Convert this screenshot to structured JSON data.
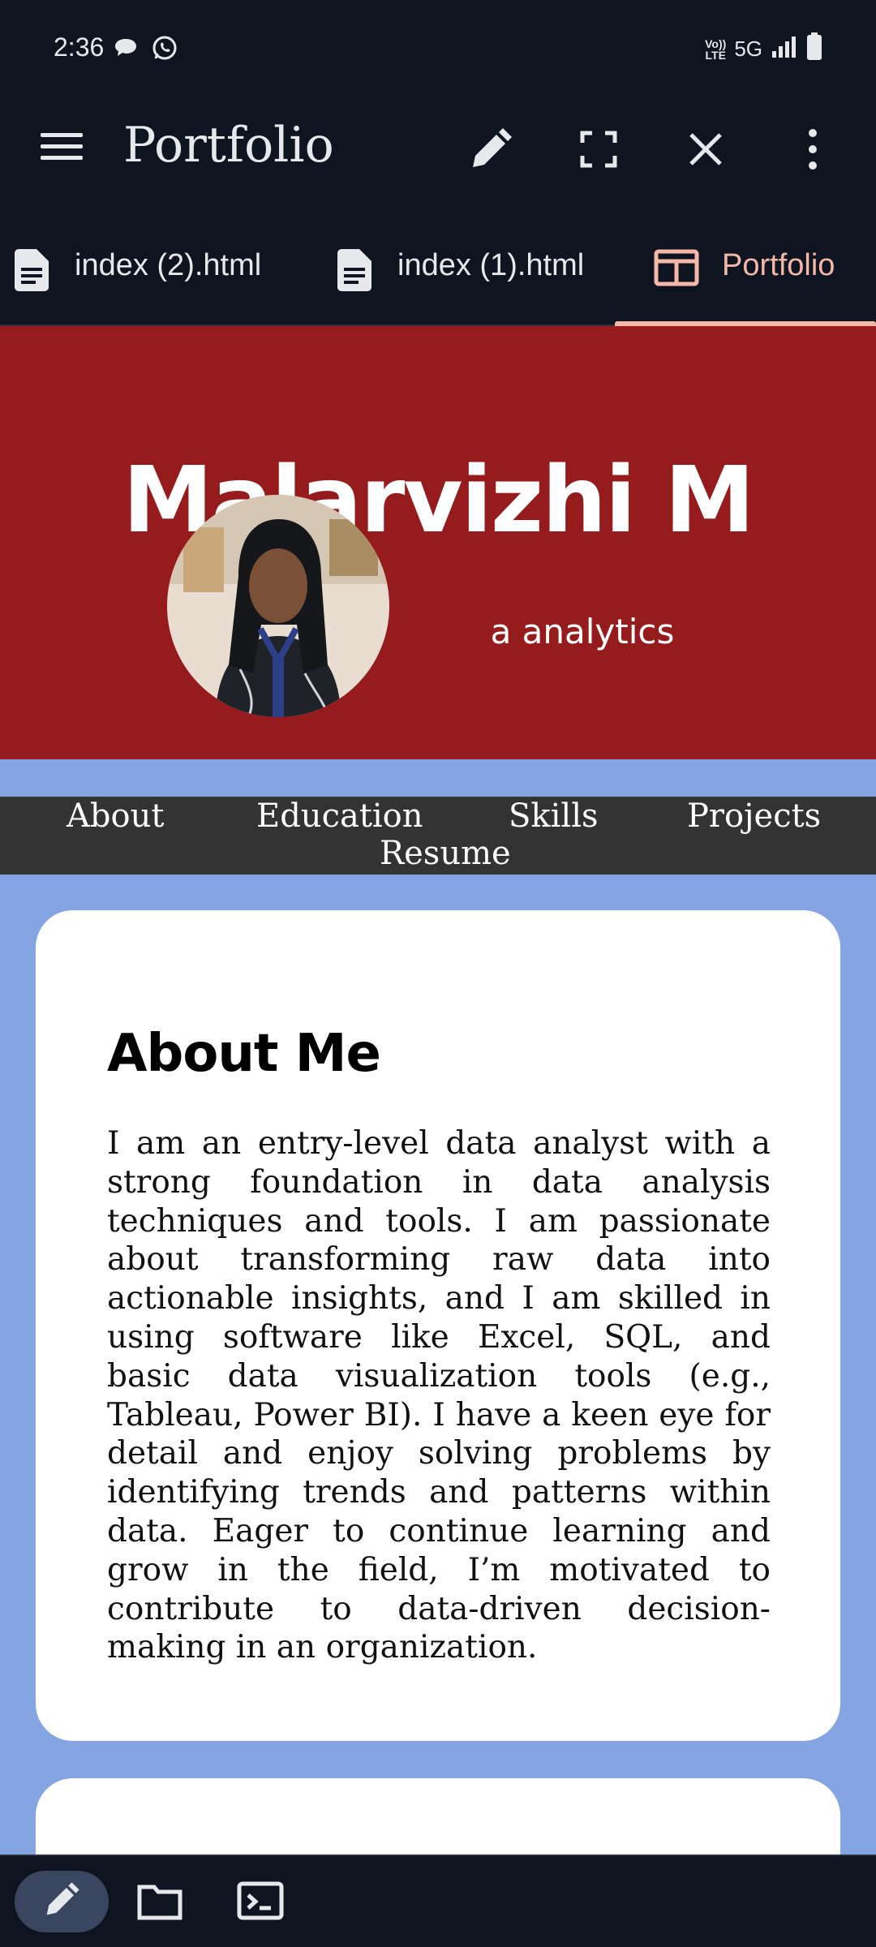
{
  "status_bar": {
    "time": "2:36",
    "network": "5G",
    "volte_top": "Vo))",
    "volte_bottom": "LTE",
    "icons": [
      "chat-bubble-icon",
      "whatsapp-icon",
      "signal-icon",
      "battery-icon"
    ]
  },
  "app_bar": {
    "title": "Portfolio",
    "actions": [
      "edit-icon",
      "fullscreen-icon",
      "close-icon",
      "more-vert-icon"
    ]
  },
  "tabs": [
    {
      "label": "index (2).html",
      "icon": "file-icon",
      "active": false
    },
    {
      "label": "index (1).html",
      "icon": "file-icon",
      "active": false
    },
    {
      "label": "Portfolio",
      "icon": "web-preview-icon",
      "active": true
    }
  ],
  "page": {
    "hero": {
      "name": "Malarvizhi M",
      "subtitle": "a analytics"
    },
    "nav": [
      "About",
      "Education",
      "Skills",
      "Projects",
      "Resume"
    ],
    "about": {
      "heading": "About Me",
      "body": "I am an entry-level data analyst with a strong foundation in data analysis techniques and tools. I am passionate about transforming raw data into actionable insights, and I am skilled in using software like Excel, SQL, and basic data visualization tools (e.g., Tableau, Power BI). I have a keen eye for detail and enjoy solving problems by identifying trends and patterns within data. Eager to continue learning and grow in the field, I’m motivated to contribute to data-driven decision-making in an organization."
    }
  },
  "bottom_bar": {
    "items": [
      "edit-icon",
      "folder-icon",
      "terminal-icon"
    ],
    "active": "edit-icon"
  },
  "colors": {
    "chrome_bg": "#0f1520",
    "accent": "#f4b7a8",
    "hero_bg": "#961b1c",
    "page_bg": "#84a4e2",
    "nav_bg": "#333333"
  }
}
